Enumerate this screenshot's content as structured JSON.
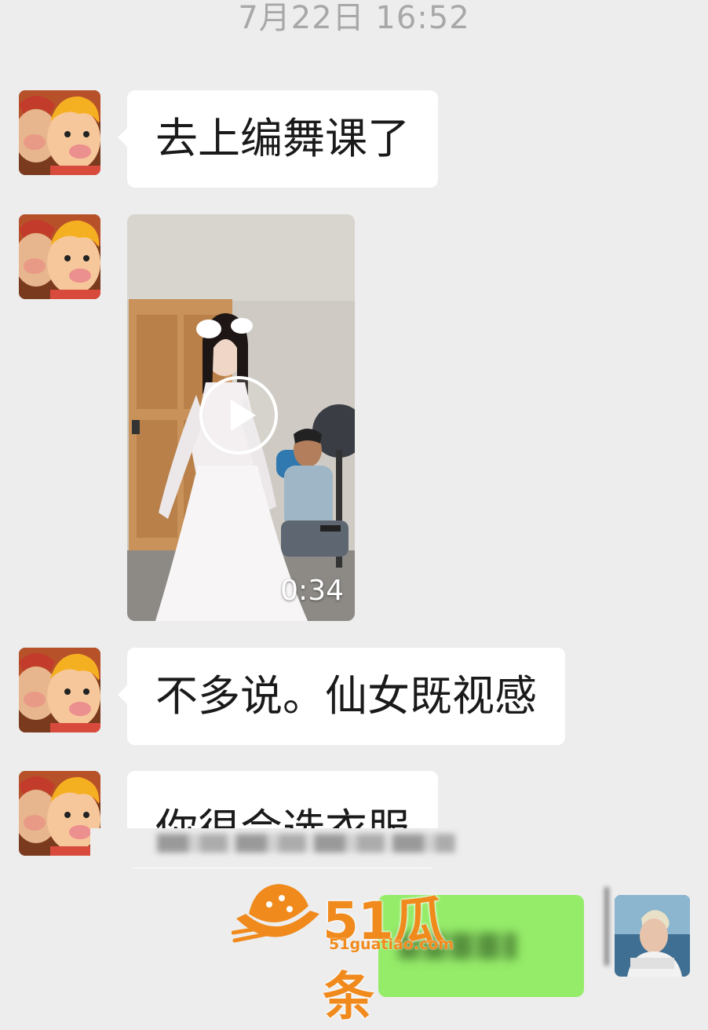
{
  "timestamp": "7月22日 16:52",
  "messages": [
    {
      "type": "text",
      "text": "去上编舞课了"
    },
    {
      "type": "video",
      "duration": "0:34"
    },
    {
      "type": "text",
      "text": "不多说。仙女既视感"
    },
    {
      "type": "text",
      "text": "你很会选衣服"
    }
  ],
  "watermark": {
    "main": "51瓜条",
    "sub": "51guatiao.com"
  },
  "colors": {
    "background": "#ededed",
    "incoming_bubble": "#ffffff",
    "outgoing_bubble": "#95ec69",
    "watermark": "#f08a1c"
  },
  "icons": {
    "play": "play-icon"
  }
}
